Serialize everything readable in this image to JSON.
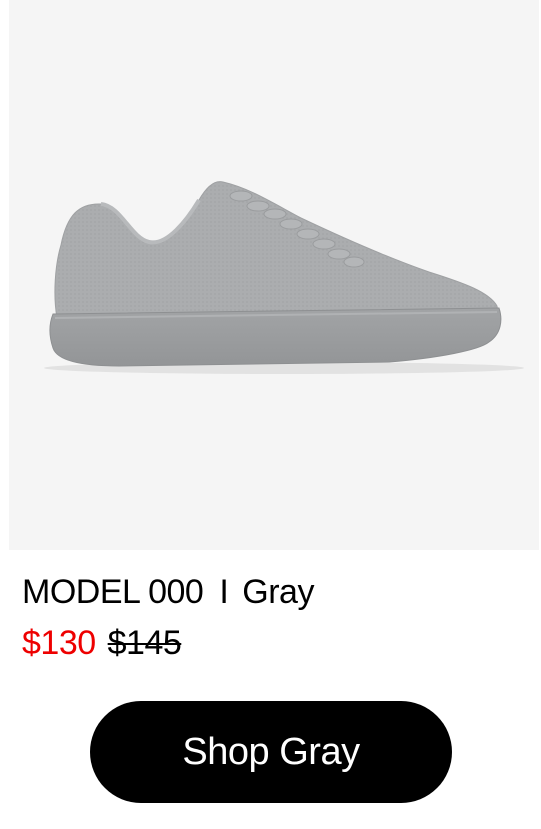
{
  "product": {
    "model": "MODEL 000",
    "separator": "I",
    "color_name": "Gray",
    "sale_price": "$130",
    "original_price": "$145",
    "image_icon": "gray-sneaker-image"
  },
  "cta": {
    "label": "Shop Gray"
  },
  "colors": {
    "sale_price": "#ee0000",
    "button_bg": "#000000",
    "button_text": "#ffffff",
    "image_bg": "#f5f5f5",
    "shoe_upper": "#a9abad",
    "shoe_sole": "#9c9ea0"
  }
}
